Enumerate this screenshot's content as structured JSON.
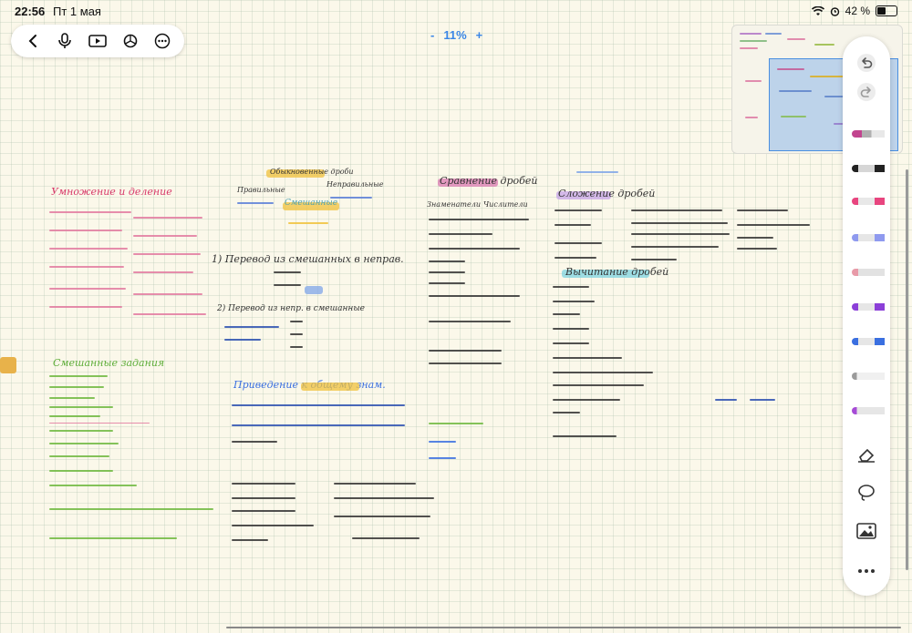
{
  "status_bar": {
    "time": "22:56",
    "date": "Пт 1 мая",
    "battery_percent": "42 %",
    "battery_level": 0.42
  },
  "toolbar": {
    "items": [
      "back-icon",
      "microphone-icon",
      "video-icon",
      "chatgpt-icon",
      "more-icon"
    ]
  },
  "zoom": {
    "minus": "-",
    "value": "11%",
    "plus": "+"
  },
  "tools": {
    "items": [
      "undo-icon",
      "redo-icon",
      "fountain-pen",
      "marker-black",
      "marker-pink",
      "pen-blue",
      "highlighter-pink",
      "pen-purple",
      "pen-blue-2",
      "pencil-gray",
      "pen-purple-2",
      "eraser-icon",
      "lasso-icon",
      "image-icon",
      "more-icon"
    ],
    "colors": {
      "fountain_pen": "#c2448f",
      "marker_black": "#222222",
      "marker_pink": "#e8457f",
      "pen_blue": "#8f9aef",
      "highlighter_pink": "#e89aa8",
      "pen_purple": "#8b3fd8",
      "pen_blue_2": "#3a6fe0",
      "pencil_gray": "#9b9b9b",
      "pen_purple_2": "#a64bd6"
    }
  },
  "canvas": {
    "headings": {
      "multiplication": "Умножение и деление",
      "fraction_types": "Обыкновенные дроби",
      "proper": "Правильные",
      "improper": "Неправильные",
      "mixed": "Смешанные",
      "to_improper": "1) Перевод из смешанных в неправ.",
      "to_mixed": "2) Перевод из непр. в смешанные",
      "common_denominator": "Приведение к общему знам.",
      "comparison": "Сравнение дробей",
      "same_den": "Знаменатели",
      "same_num": "Числители",
      "addition": "Сложение дробей",
      "subtraction": "Вычитание дробей",
      "combined": "Смешанные задания"
    }
  }
}
